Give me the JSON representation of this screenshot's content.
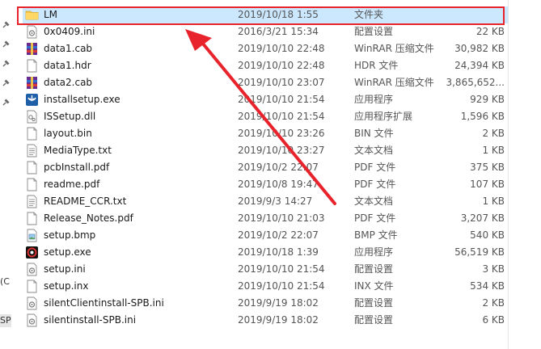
{
  "left_panel": {
    "text_c": "(C",
    "text_sp": "SP"
  },
  "files": [
    {
      "name": "LM",
      "date": "2019/10/18 1:55",
      "type": "文件夹",
      "size": "",
      "icon": "folder-icon",
      "selected": true
    },
    {
      "name": "0x0409.ini",
      "date": "2016/3/21 15:34",
      "type": "配置设置",
      "size": "22 KB",
      "icon": "config-file-icon"
    },
    {
      "name": "data1.cab",
      "date": "2019/10/10 22:48",
      "type": "WinRAR 压缩文件",
      "size": "30,982 KB",
      "icon": "winrar-archive-icon"
    },
    {
      "name": "data1.hdr",
      "date": "2019/10/10 22:48",
      "type": "HDR 文件",
      "size": "24,394 KB",
      "icon": "blank-file-icon"
    },
    {
      "name": "data2.cab",
      "date": "2019/10/10 23:07",
      "type": "WinRAR 压缩文件",
      "size": "3,865,652...",
      "icon": "winrar-archive-icon"
    },
    {
      "name": "installsetup.exe",
      "date": "2019/10/10 21:54",
      "type": "应用程序",
      "size": "929 KB",
      "icon": "installer-app-icon"
    },
    {
      "name": "ISSetup.dll",
      "date": "2019/10/10 21:54",
      "type": "应用程序扩展",
      "size": "1,596 KB",
      "icon": "dll-file-icon"
    },
    {
      "name": "layout.bin",
      "date": "2019/10/10 23:26",
      "type": "BIN 文件",
      "size": "2 KB",
      "icon": "blank-file-icon"
    },
    {
      "name": "MediaType.txt",
      "date": "2019/10/10 23:27",
      "type": "文本文档",
      "size": "1 KB",
      "icon": "text-file-icon"
    },
    {
      "name": "pcbInstall.pdf",
      "date": "2019/10/2 22:07",
      "type": "PDF 文件",
      "size": "375 KB",
      "icon": "blank-file-icon"
    },
    {
      "name": "readme.pdf",
      "date": "2019/10/8 19:47",
      "type": "PDF 文件",
      "size": "107 KB",
      "icon": "blank-file-icon"
    },
    {
      "name": "README_CCR.txt",
      "date": "2019/9/3 14:27",
      "type": "文本文档",
      "size": "1 KB",
      "icon": "text-file-icon"
    },
    {
      "name": "Release_Notes.pdf",
      "date": "2019/10/10 21:03",
      "type": "PDF 文件",
      "size": "3,207 KB",
      "icon": "blank-file-icon"
    },
    {
      "name": "setup.bmp",
      "date": "2019/10/2 22:07",
      "type": "BMP 文件",
      "size": "540 KB",
      "icon": "image-file-icon"
    },
    {
      "name": "setup.exe",
      "date": "2019/10/18 1:39",
      "type": "应用程序",
      "size": "56,519 KB",
      "icon": "setup-app-icon"
    },
    {
      "name": "setup.ini",
      "date": "2019/10/10 21:54",
      "type": "配置设置",
      "size": "3 KB",
      "icon": "config-file-icon"
    },
    {
      "name": "setup.inx",
      "date": "2019/10/10 21:54",
      "type": "INX 文件",
      "size": "534 KB",
      "icon": "blank-file-icon"
    },
    {
      "name": "silentClientinstall-SPB.ini",
      "date": "2019/9/19 18:02",
      "type": "配置设置",
      "size": "2 KB",
      "icon": "config-file-icon"
    },
    {
      "name": "silentinstall-SPB.ini",
      "date": "2019/9/19 18:02",
      "type": "配置设置",
      "size": "6 KB",
      "icon": "config-file-icon"
    }
  ],
  "colors": {
    "selection": "#cce8ff",
    "annotation_red": "#e8232b",
    "folder_yellow": "#f4c542"
  }
}
